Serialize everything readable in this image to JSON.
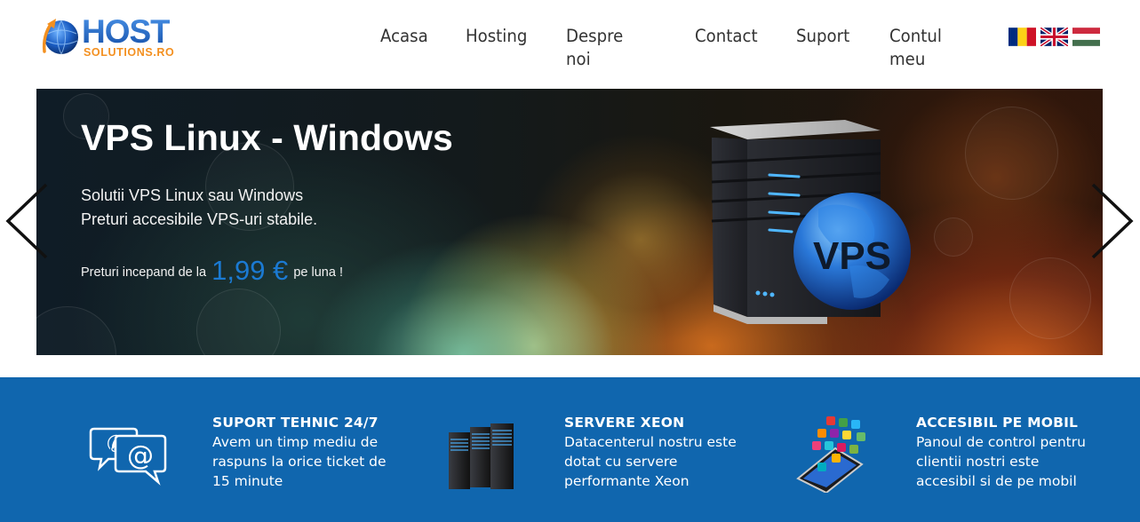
{
  "brand": {
    "name_main": "HOST",
    "name_sub": "SOLUTIONS.RO",
    "colors": {
      "primary_blue": "#1d5fc0",
      "orange": "#f39020"
    }
  },
  "nav": {
    "items": [
      {
        "label": "Acasa"
      },
      {
        "label": "Hosting"
      },
      {
        "label": "Despre noi"
      },
      {
        "label": "Contact"
      },
      {
        "label": "Suport"
      },
      {
        "label": "Contul meu"
      }
    ]
  },
  "languages": [
    {
      "code": "ro",
      "icon": "flag-romania-icon"
    },
    {
      "code": "en",
      "icon": "flag-uk-icon"
    },
    {
      "code": "hu",
      "icon": "flag-hungary-icon"
    }
  ],
  "slider": {
    "title": "VPS Linux - Windows",
    "desc_line1": "Solutii VPS Linux sau Windows",
    "desc_line2": "Preturi accesibile VPS-uri stabile.",
    "price_prefix": "Preturi incepand de la",
    "price_amount": "1,99 €",
    "price_suffix": "pe luna !",
    "badge_text": "VPS",
    "prev_icon": "chevron-left-icon",
    "next_icon": "chevron-right-icon",
    "price_color": "#1b7ad2"
  },
  "features": {
    "background": "#1066ae",
    "items": [
      {
        "title": "SUPORT TEHNIC 24/7",
        "text": "Avem un timp mediu de raspuns la orice ticket de 15 minute",
        "icon": "support-chat-icon"
      },
      {
        "title": "SERVERE XEON",
        "text": "Datacenterul nostru este dotat cu servere performante Xeon",
        "icon": "server-rack-icon"
      },
      {
        "title": "ACCESIBIL PE MOBIL",
        "text": "Panoul de control pentru clientii nostri este accesibil si de pe mobil",
        "icon": "mobile-apps-icon"
      }
    ]
  }
}
